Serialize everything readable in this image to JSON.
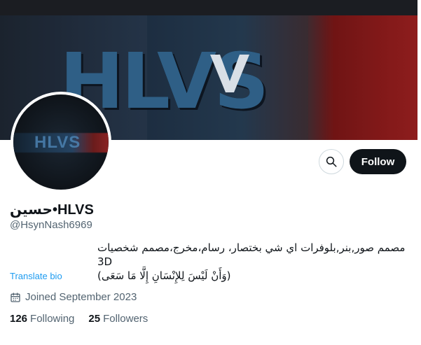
{
  "profile": {
    "display_name": "حسين•HLVS",
    "handle": "@HsynNash6969",
    "bio": [
      "مصمم صور,بنر,بلوفرات اي شي بختصار، رسام،مخرج،مصمم شخصيات 3D",
      "(وَأَنْ لَيْسَ لِلإِنْسَانِ إِلَّا مَا سَعَى)"
    ],
    "translate_bio": "Translate bio",
    "joined": "Joined September 2023",
    "following_count": "126",
    "following_label": "Following",
    "followers_count": "25",
    "followers_label": "Followers"
  },
  "actions": {
    "follow_label": "Follow",
    "search_icon": "search-icon"
  },
  "banner": {
    "text": "HLVS",
    "accent_colors": [
      "#1b1d22",
      "#23384d",
      "#8a1f1f"
    ]
  },
  "avatar": {
    "text": "HLVS"
  },
  "icons": {
    "calendar": "calendar-icon"
  }
}
